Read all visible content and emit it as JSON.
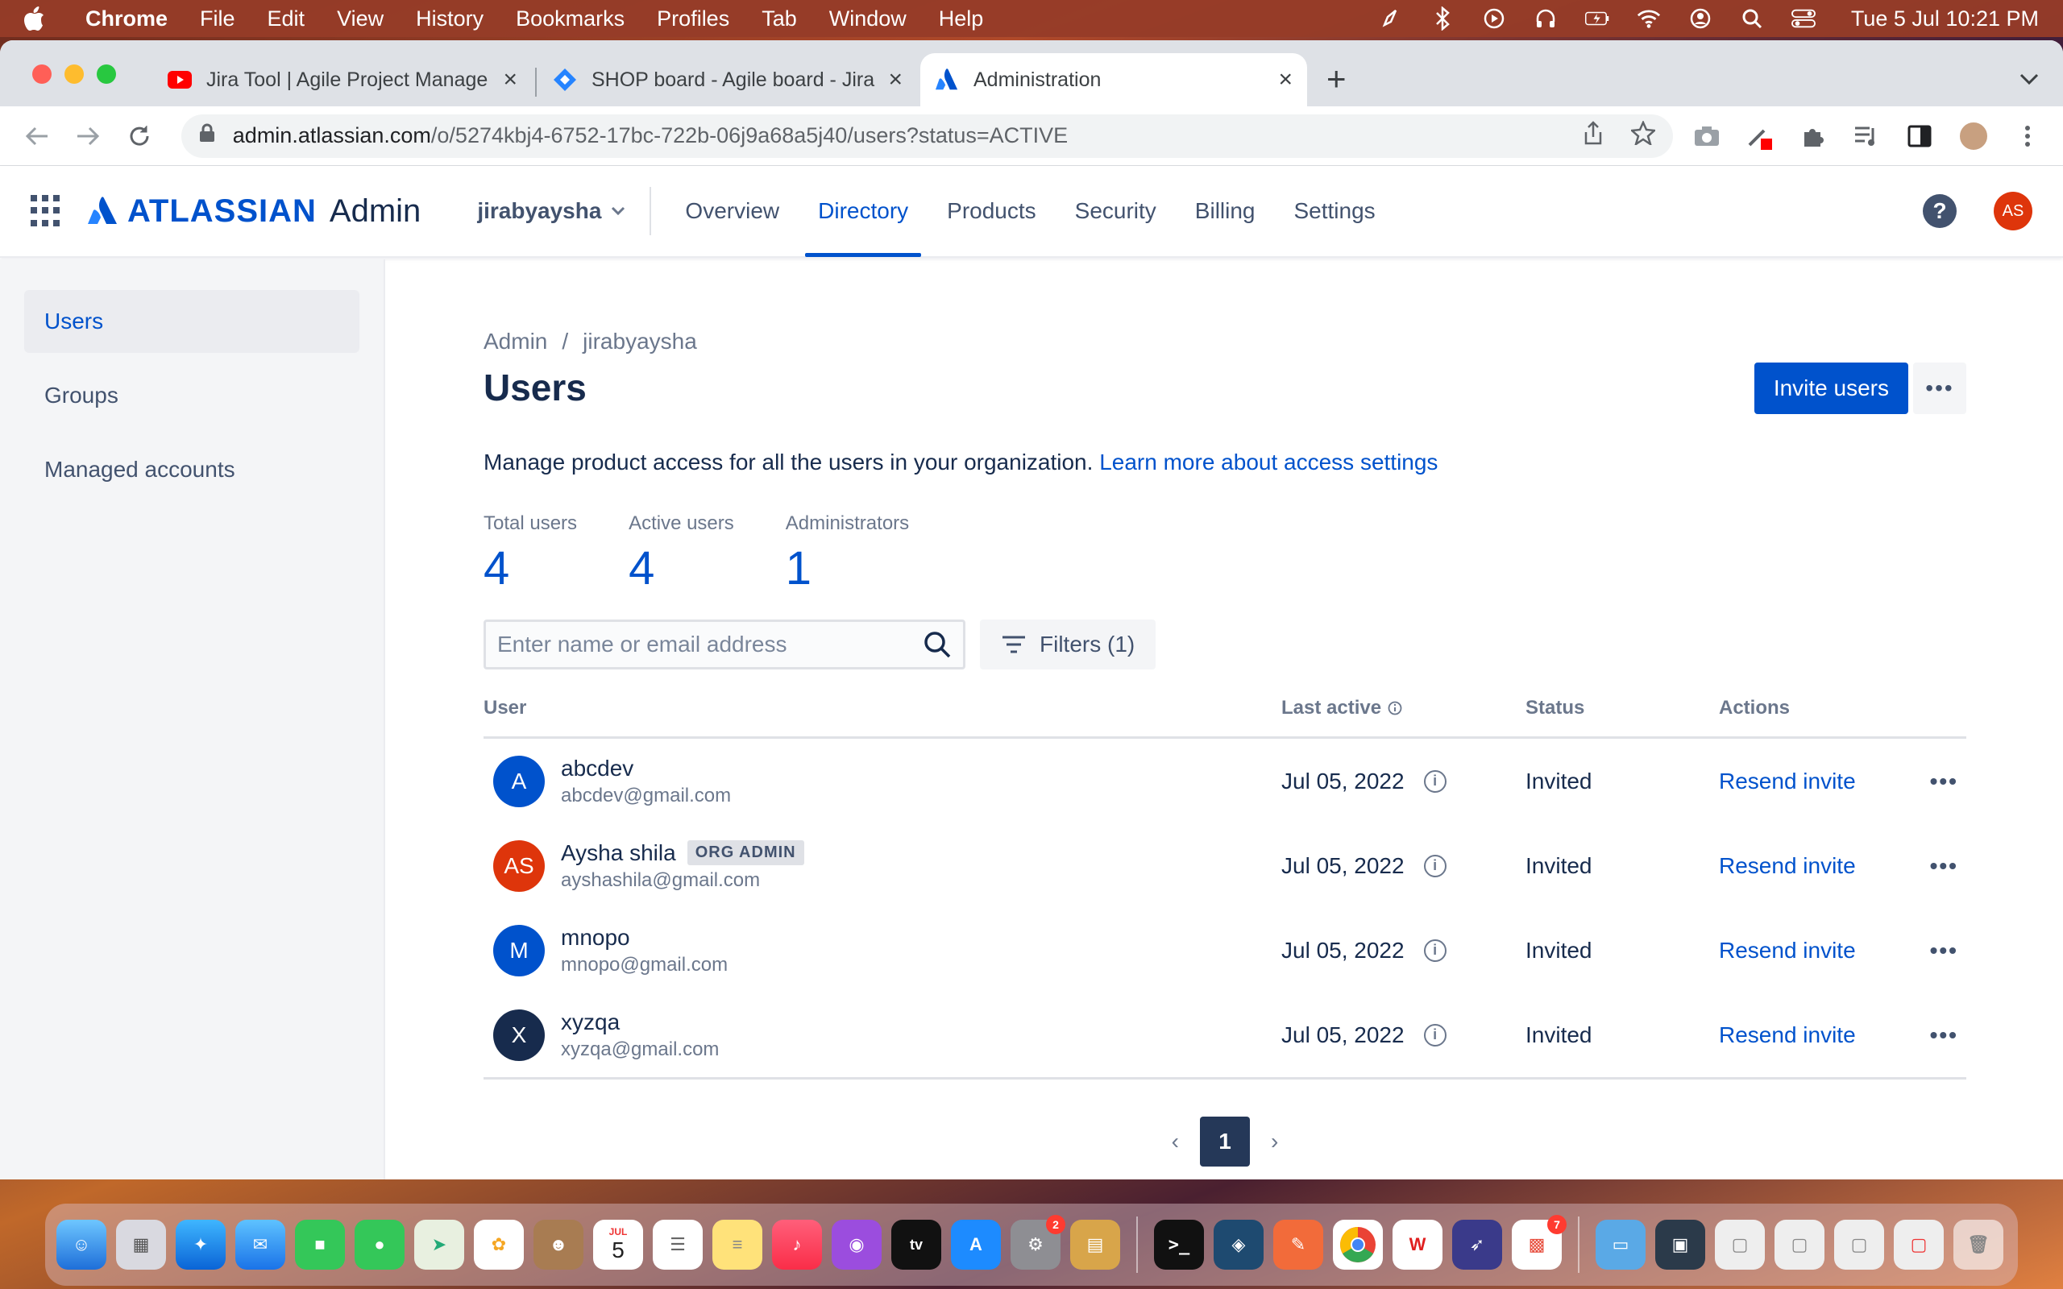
{
  "menubar": {
    "app_name": "Chrome",
    "items": [
      "File",
      "Edit",
      "View",
      "History",
      "Bookmarks",
      "Profiles",
      "Tab",
      "Window",
      "Help"
    ],
    "clock": "Tue 5 Jul  10:21 PM"
  },
  "tabs": [
    {
      "title": "Jira Tool | Agile Project Manage",
      "icon": "youtube-icon"
    },
    {
      "title": "SHOP board - Agile board - Jira",
      "icon": "jira-icon"
    },
    {
      "title": "Administration",
      "icon": "atlassian-icon"
    }
  ],
  "omnibox": {
    "host": "admin.atlassian.com",
    "path": "/o/5274kbj4-6752-17bc-722b-06j9a68a5j40/users?status=ACTIVE"
  },
  "topnav": {
    "logo_word": "ATLASSIAN",
    "logo_admin": "Admin",
    "site": "jirabyaysha",
    "items": [
      "Overview",
      "Directory",
      "Products",
      "Security",
      "Billing",
      "Settings"
    ],
    "active": "Directory",
    "help_label": "?",
    "avatar_initials": "AS"
  },
  "sidebar": {
    "items": [
      {
        "label": "Users",
        "active": true
      },
      {
        "label": "Groups",
        "active": false
      },
      {
        "label": "Managed accounts",
        "active": false
      }
    ]
  },
  "main": {
    "breadcrumb": [
      "Admin",
      "/",
      "jirabyaysha"
    ],
    "title": "Users",
    "invite_label": "Invite users",
    "more_label": "•••",
    "description": "Manage product access for all the users in your organization.",
    "learn_more": "Learn more about access settings",
    "stats": [
      {
        "label": "Total users",
        "value": "4"
      },
      {
        "label": "Active users",
        "value": "4"
      },
      {
        "label": "Administrators",
        "value": "1"
      }
    ],
    "search_placeholder": "Enter name or email address",
    "filters_label": "Filters (1)"
  },
  "table": {
    "headers": {
      "user": "User",
      "last_active": "Last active",
      "status": "Status",
      "actions": "Actions"
    },
    "rows": [
      {
        "initials": "A",
        "name": "abcdev",
        "email": "abcdev@gmail.com",
        "badge": "",
        "last_active": "Jul 05, 2022",
        "status": "Invited",
        "action": "Resend invite",
        "avatar_color": "#0052CC"
      },
      {
        "initials": "AS",
        "name": "Aysha shila",
        "email": "ayshashila@gmail.com",
        "badge": "ORG ADMIN",
        "last_active": "Jul 05, 2022",
        "status": "Invited",
        "action": "Resend invite",
        "avatar_color": "#DE350B"
      },
      {
        "initials": "M",
        "name": "mnopo",
        "email": "mnopo@gmail.com",
        "badge": "",
        "last_active": "Jul 05, 2022",
        "status": "Invited",
        "action": "Resend invite",
        "avatar_color": "#0052CC"
      },
      {
        "initials": "X",
        "name": "xyzqa",
        "email": "xyzqa@gmail.com",
        "badge": "",
        "last_active": "Jul 05, 2022",
        "status": "Invited",
        "action": "Resend invite",
        "avatar_color": "#172B4D"
      }
    ],
    "page": "1"
  },
  "colors": {
    "primary": "#0052CC",
    "text": "#172B4D",
    "subtle": "#6B778C"
  },
  "dock": {
    "calendar_month": "JUL",
    "calendar_day": "5",
    "settings_badge": "2",
    "office_badge": "7"
  }
}
